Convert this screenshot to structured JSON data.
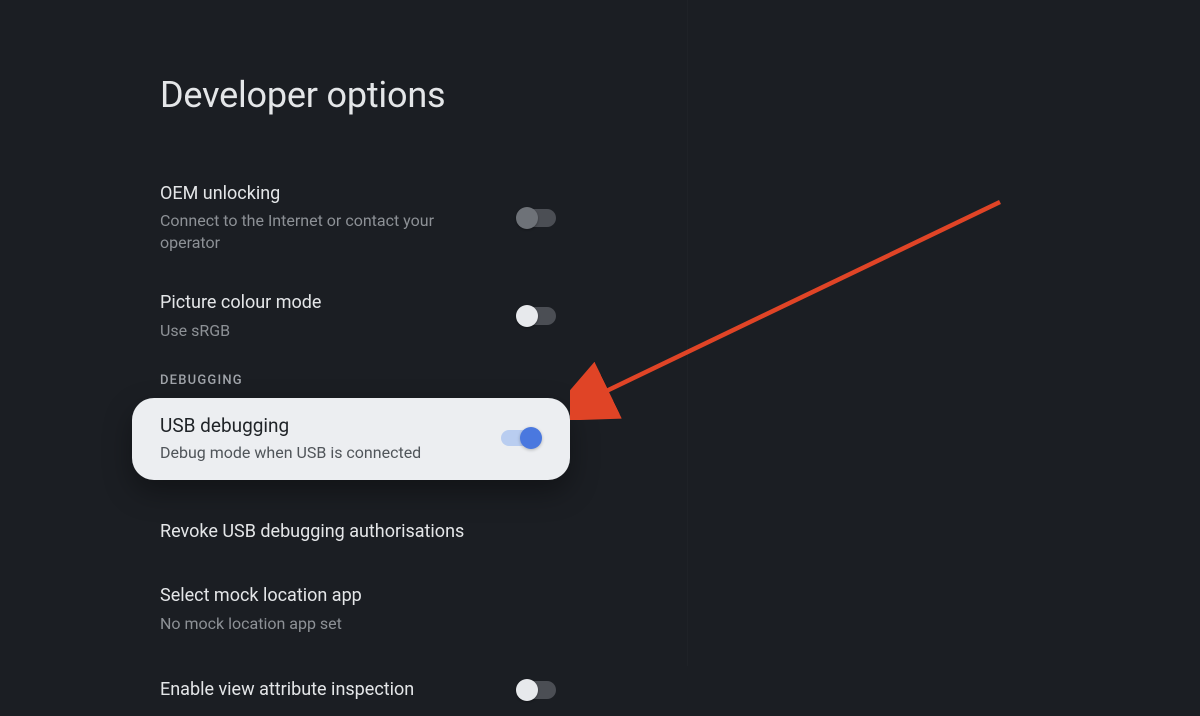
{
  "page": {
    "title": "Developer options"
  },
  "items": {
    "oem": {
      "title": "OEM unlocking",
      "subtitle": "Connect to the Internet or contact your operator",
      "state": "disabled"
    },
    "picture": {
      "title": "Picture colour mode",
      "subtitle": "Use sRGB",
      "state": "off"
    },
    "section_debugging": "DEBUGGING",
    "usb_debugging": {
      "title": "USB debugging",
      "subtitle": "Debug mode when USB is connected",
      "state": "on"
    },
    "revoke": {
      "title": "Revoke USB debugging authorisations"
    },
    "mock_location": {
      "title": "Select mock location app",
      "subtitle": "No mock location app set"
    },
    "view_attr": {
      "title": "Enable view attribute inspection",
      "state": "off"
    }
  },
  "annotation": {
    "arrow_color": "#e04426"
  }
}
